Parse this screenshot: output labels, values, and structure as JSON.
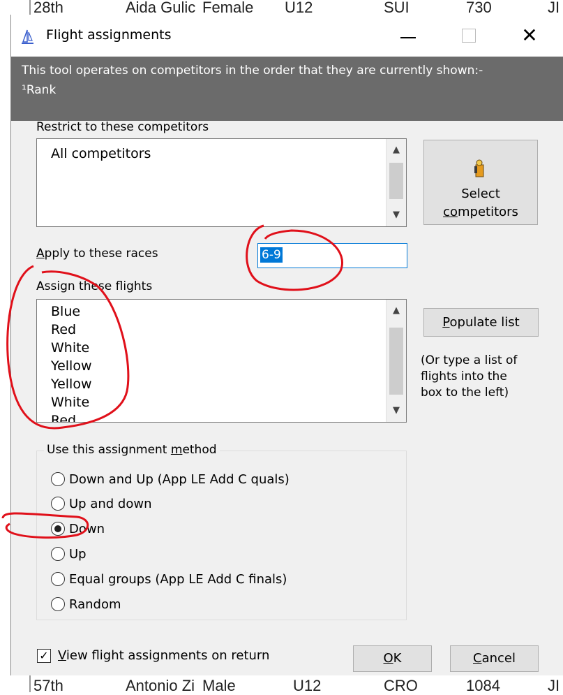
{
  "background_rows": {
    "top": {
      "rank": "28th",
      "name": "Aida Gulic",
      "gender": "Female",
      "division": "U12",
      "country": "SUI",
      "points": "730",
      "extra": "JI"
    },
    "bottom": {
      "rank": "57th",
      "name": "Antonio Zi",
      "gender": "Male",
      "division": "U12",
      "country": "CRO",
      "points": "1084",
      "extra": "JI"
    }
  },
  "window": {
    "title": "Flight assignments",
    "minimize_icon": "minimize-icon",
    "maximize_icon": "maximize-icon",
    "close_glyph": "✕"
  },
  "info": {
    "line1": "This tool operates on competitors in the order that they are currently shown:-",
    "line2": "¹Rank"
  },
  "restrict": {
    "label": "Restrict to these competitors",
    "items": [
      "All competitors"
    ]
  },
  "select_button": {
    "line1": "Select",
    "line2_underlined": "co",
    "line2_rest": "mpetitors",
    "icon": "select-competitors-icon"
  },
  "races": {
    "label_underlined": "A",
    "label_rest": "pply to these races",
    "value": "6-9"
  },
  "flights": {
    "label": "Assign these flights",
    "items": [
      "Blue",
      "Red",
      "White",
      "Yellow",
      "Yellow",
      "White",
      "Red"
    ]
  },
  "populate_button": {
    "underlined": "P",
    "rest": "opulate list"
  },
  "hint": {
    "line1": "(Or type a list of",
    "line2": "flights into the",
    "line3": "box to the left)"
  },
  "method": {
    "legend_before": "Use this assignment ",
    "legend_underlined": "m",
    "legend_after": "ethod",
    "options": [
      {
        "label": "Down and Up (App LE Add C quals)",
        "checked": false
      },
      {
        "label": "Up and down",
        "checked": false
      },
      {
        "label": "Down",
        "checked": true
      },
      {
        "label": "Up",
        "checked": false
      },
      {
        "label": "Equal groups (App LE Add C finals)",
        "checked": false
      },
      {
        "label": "Random",
        "checked": false
      }
    ]
  },
  "view_checkbox": {
    "checked": true,
    "label_underlined": "V",
    "label_rest": "iew flight assignments on return"
  },
  "ok_button": {
    "underlined": "O",
    "rest": "K"
  },
  "cancel_button": {
    "underlined": "C",
    "rest": "ancel"
  },
  "annotation_color": "#e0101a",
  "accent_color": "#0078d7"
}
